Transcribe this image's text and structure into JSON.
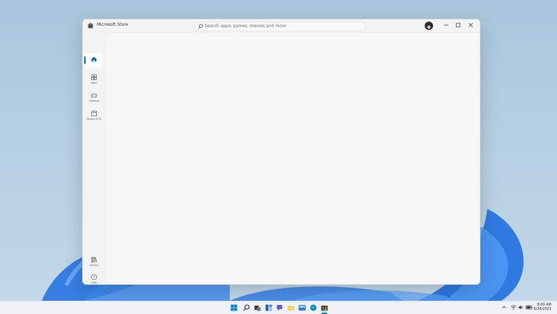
{
  "window": {
    "title": "Microsoft Store",
    "search_placeholder": "Search apps, games, movies and more"
  },
  "nav": {
    "items": [
      {
        "key": "home",
        "label": ""
      },
      {
        "key": "apps",
        "label": "Apps"
      },
      {
        "key": "gaming",
        "label": "Gaming"
      },
      {
        "key": "movies",
        "label": "Movies & TV"
      }
    ],
    "bottom": [
      {
        "key": "library",
        "label": "Library"
      },
      {
        "key": "help",
        "label": "Help"
      }
    ]
  },
  "taskbar": {
    "time": "8:00 AM",
    "date": "6/24/2021"
  },
  "colors": {
    "accent": "#0067c0",
    "window_bg": "#f3f3f3",
    "taskbar_bg": "#eef2f7"
  }
}
